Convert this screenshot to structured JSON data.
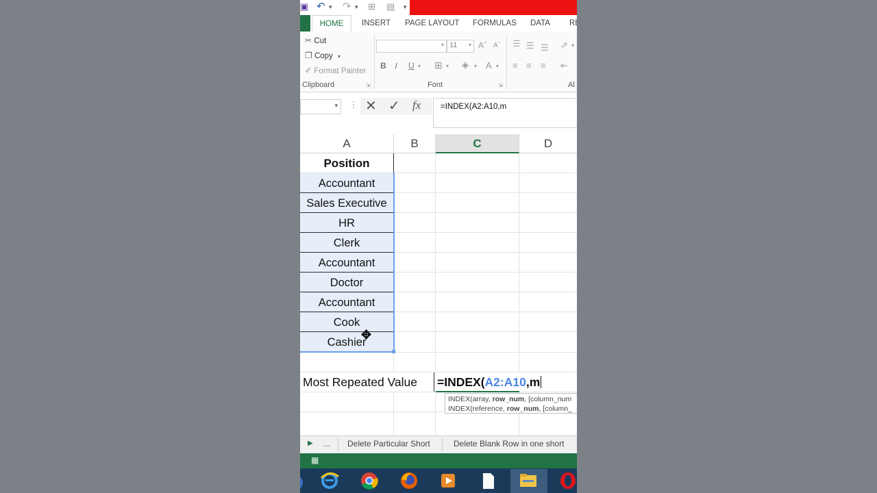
{
  "ribbon": {
    "tabs": [
      "HOME",
      "INSERT",
      "PAGE LAYOUT",
      "FORMULAS",
      "DATA",
      "RE"
    ],
    "clipboard": {
      "cut": "Cut",
      "copy": "Copy",
      "format_painter": "Format Painter",
      "label": "Clipboard"
    },
    "font": {
      "size": "11",
      "bold": "B",
      "italic": "I",
      "underline": "U",
      "label": "Font"
    },
    "alignment_label": "Al"
  },
  "formula_bar": {
    "fx": "fx",
    "value": "=INDEX(A2:A10,m"
  },
  "sheet": {
    "columns": [
      "A",
      "B",
      "C",
      "D"
    ],
    "active_column": "C",
    "header": "Position",
    "positions": [
      "Accountant",
      "Sales Executive",
      "HR",
      "Clerk",
      "Accountant",
      "Doctor",
      "Accountant",
      "Cook",
      "Cashier"
    ],
    "label_cell": "Most Repeated Value",
    "edit_cell": {
      "prefix": "=INDEX(",
      "ref": "A2:A10",
      "suffix": ",m"
    },
    "tooltip": {
      "line1": {
        "pre": "INDEX(array, ",
        "bold": "row_num",
        "post": ", [column_num"
      },
      "line2": {
        "pre": "INDEX(reference, ",
        "bold": "row_num",
        "post": ", [column_"
      }
    }
  },
  "sheet_tabs": {
    "more": "...",
    "tab1": "Delete Particular Short",
    "tab2": "Delete Blank Row in one short"
  },
  "colors": {
    "excel_green": "#217346",
    "ref_blue": "#4a86e8",
    "red_bar": "#ee1111"
  }
}
